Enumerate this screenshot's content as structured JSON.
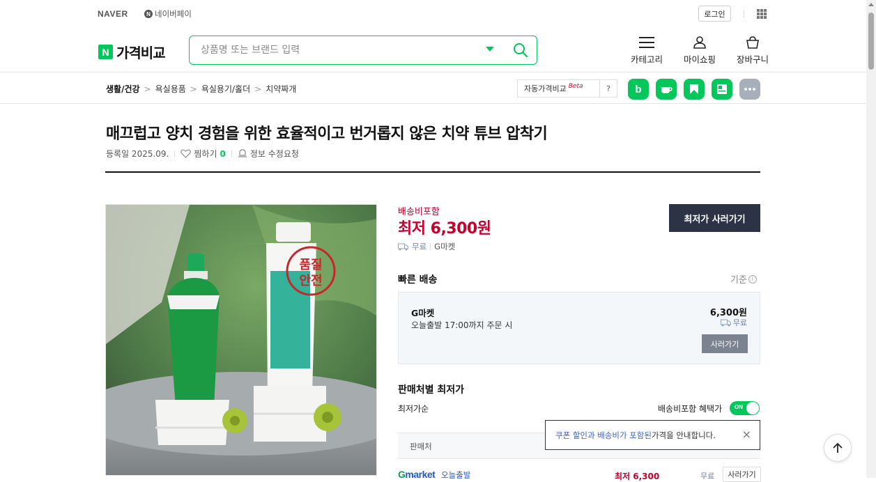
{
  "topbar": {
    "naver": "NAVER",
    "npay": "네이버페이",
    "npay_badge": "N",
    "login": "로그인"
  },
  "header": {
    "brand_badge": "N",
    "brand": "가격비교",
    "search_placeholder": "상품명 또는 브랜드 입력",
    "menu_category": "카테고리",
    "menu_myshopping": "마이쇼핑",
    "menu_cart": "장바구니"
  },
  "breadcrumb": [
    "생활/건강",
    "욕실용품",
    "욕실용기/홀더",
    "치약짜개"
  ],
  "breadcrumb_sep": ">",
  "tools": {
    "auto_price": "자동가격비교",
    "beta": "Beta",
    "help": "?",
    "band_label": "b",
    "more_icon": "more-icon"
  },
  "product": {
    "title": "매끄럽고 양치 경험을 위한 효율적이고 번거롭지 않은 치약 튜브 압착기",
    "registered": "등록일 2025.09.",
    "wish_label": "찜하기",
    "wish_count": "0",
    "report": "정보 수정요청"
  },
  "image": {
    "stamp_line1": "품질",
    "stamp_line2": "안전"
  },
  "price": {
    "label": "배송비포함",
    "main": "최저 6,300원",
    "shipping": "무료",
    "seller": "G마켓",
    "buy_button": "최저가 사러가기"
  },
  "fast_delivery": {
    "heading": "빠른 배송",
    "basis": "기준",
    "basis_icon": "i",
    "seller": "G마켓",
    "desc": "오늘출발 17:00까지 주문 시",
    "price": "6,300원",
    "shipping": "무료",
    "button": "사러가기"
  },
  "sellers": {
    "heading": "판매처별 최저가",
    "sort": "최저가순",
    "include_label": "배송비포함 혜택가",
    "toggle_on": "ON",
    "column_seller": "판매처",
    "tooltip_pre": "쿠폰 할인과 배송비가 포함된",
    "tooltip_post": " 가격을 안내합니다.",
    "tooltip_close": "×",
    "rows": [
      {
        "seller_g": "G",
        "seller_rest": "market",
        "tag": "오늘출발",
        "price": "최저 6,300",
        "shipping": "무료",
        "button": "사러가기"
      }
    ]
  },
  "colors": {
    "accent": "#03c75a",
    "price_red": "#c4002b",
    "dark_button": "#2b3344",
    "link_blue": "#2559c6"
  }
}
